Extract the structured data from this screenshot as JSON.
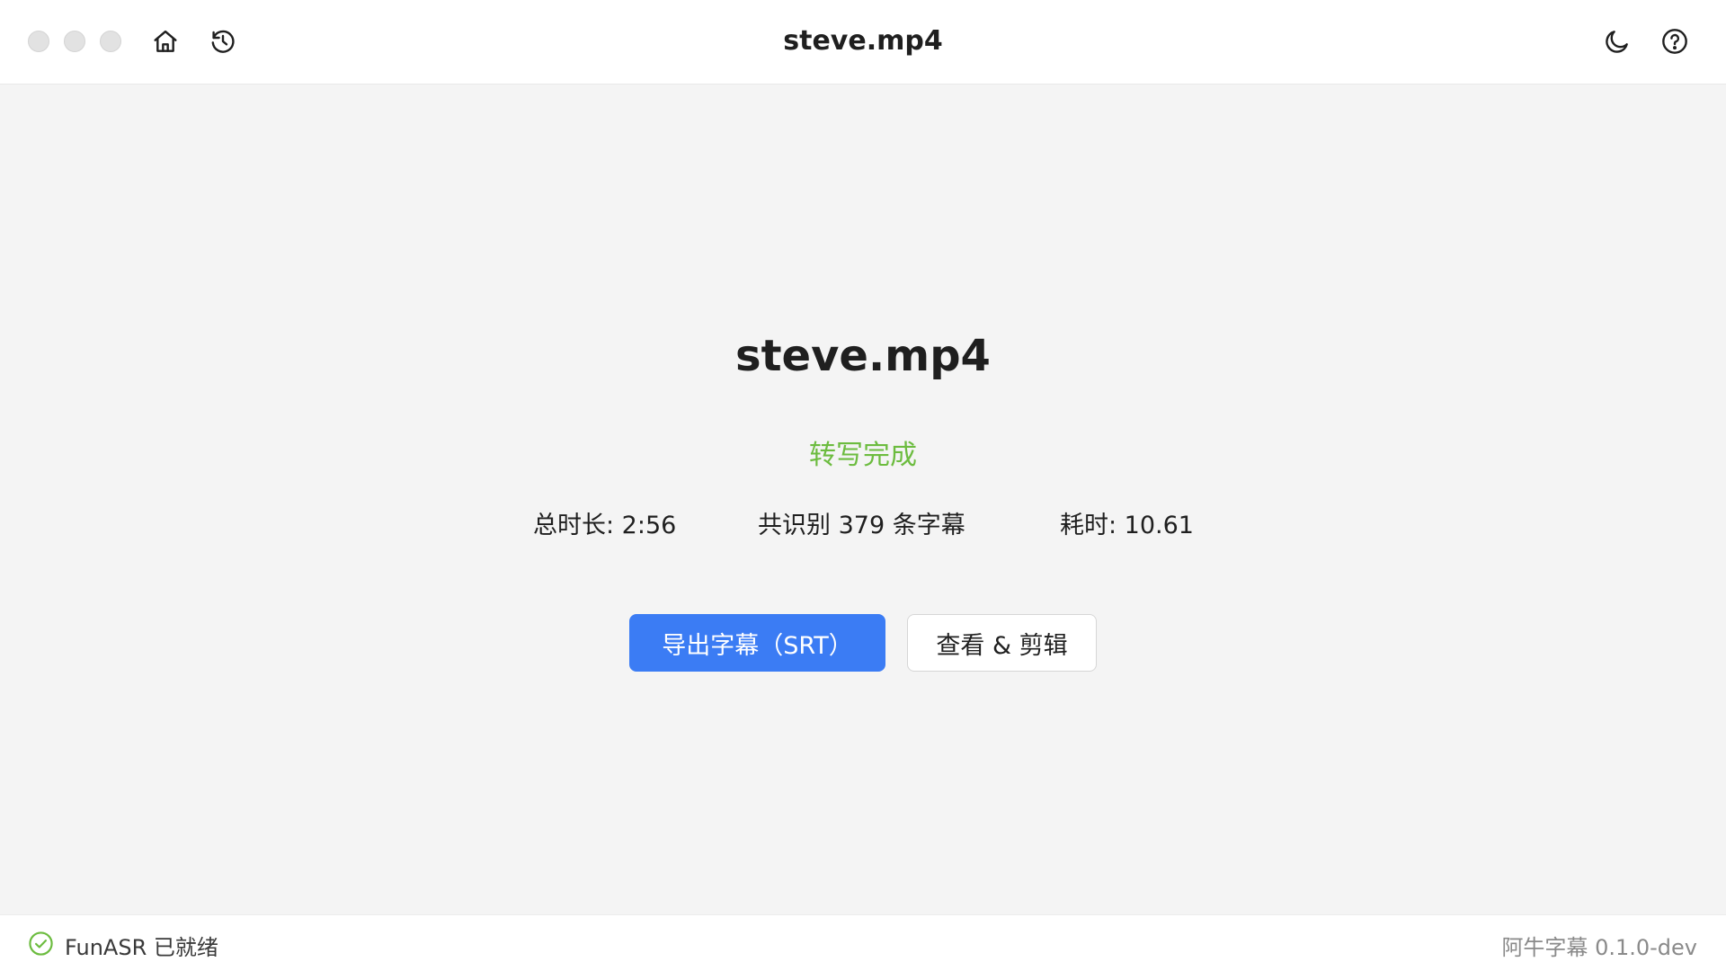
{
  "titlebar": {
    "title": "steve.mp4",
    "icons": {
      "home": "home-icon",
      "history": "history-icon",
      "theme": "moon-icon",
      "help": "help-icon"
    }
  },
  "main": {
    "file_name": "steve.mp4",
    "status": "转写完成",
    "stats": {
      "duration": "总时长: 2:56",
      "subtitle_count": "共识别 379 条字幕",
      "elapsed": "耗时: 10.61"
    },
    "buttons": {
      "export": "导出字幕（SRT）",
      "view_edit": "查看 & 剪辑"
    }
  },
  "statusbar": {
    "engine_status": "FunASR 已就绪",
    "version": "阿牛字幕 0.1.0-dev"
  },
  "colors": {
    "accent": "#3b7cf4",
    "success": "#6cbc3f",
    "background": "#f4f4f4"
  }
}
